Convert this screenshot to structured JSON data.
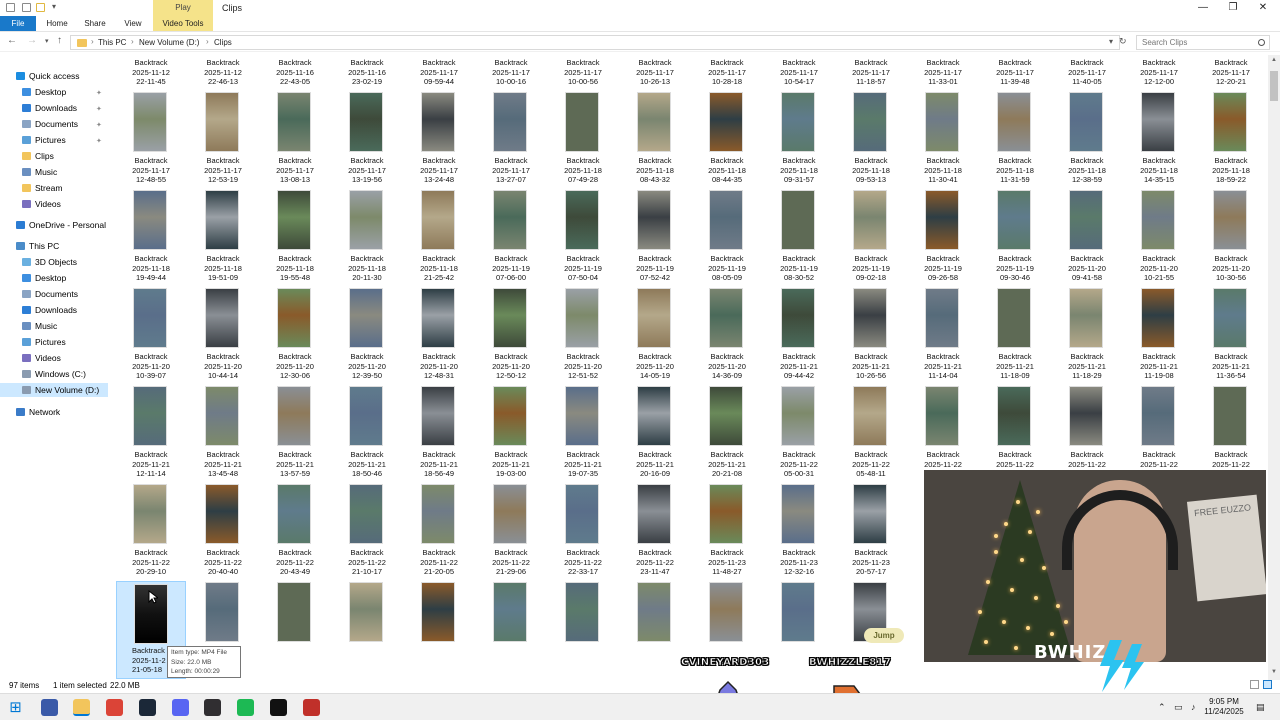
{
  "window": {
    "title": "Clips",
    "contextual_tab_group": "Play",
    "tabs": [
      "File",
      "Home",
      "Share",
      "View",
      "Video Tools"
    ],
    "minimize": "—",
    "maximize": "❐",
    "close": "✕"
  },
  "address": {
    "breadcrumbs": [
      "This PC",
      "New Volume (D:)",
      "Clips"
    ],
    "search_placeholder": "Search Clips"
  },
  "sidebar": {
    "items": [
      {
        "label": "Quick access",
        "indent": 0,
        "color": "#1b8de0",
        "pinned": false,
        "selected": false
      },
      {
        "label": "Desktop",
        "indent": 1,
        "color": "#3d8fe0",
        "pinned": true,
        "selected": false
      },
      {
        "label": "Downloads",
        "indent": 1,
        "color": "#2d7ed6",
        "pinned": true,
        "selected": false
      },
      {
        "label": "Documents",
        "indent": 1,
        "color": "#8aa4c4",
        "pinned": true,
        "selected": false
      },
      {
        "label": "Pictures",
        "indent": 1,
        "color": "#5aa0d8",
        "pinned": true,
        "selected": false
      },
      {
        "label": "Clips",
        "indent": 1,
        "color": "#f2c55c",
        "pinned": false,
        "selected": false
      },
      {
        "label": "Music",
        "indent": 1,
        "color": "#6a8fc0",
        "pinned": false,
        "selected": false
      },
      {
        "label": "Stream",
        "indent": 1,
        "color": "#f2c55c",
        "pinned": false,
        "selected": false
      },
      {
        "label": "Videos",
        "indent": 1,
        "color": "#7a6fbf",
        "pinned": false,
        "selected": false
      },
      {
        "label": "OneDrive - Personal",
        "indent": 0,
        "color": "#2b7cd3",
        "pinned": false,
        "selected": false
      },
      {
        "label": "This PC",
        "indent": 0,
        "color": "#4a8cc9",
        "pinned": false,
        "selected": false
      },
      {
        "label": "3D Objects",
        "indent": 1,
        "color": "#6ab0e0",
        "pinned": false,
        "selected": false
      },
      {
        "label": "Desktop",
        "indent": 1,
        "color": "#3d8fe0",
        "pinned": false,
        "selected": false
      },
      {
        "label": "Documents",
        "indent": 1,
        "color": "#8aa4c4",
        "pinned": false,
        "selected": false
      },
      {
        "label": "Downloads",
        "indent": 1,
        "color": "#2d7ed6",
        "pinned": false,
        "selected": false
      },
      {
        "label": "Music",
        "indent": 1,
        "color": "#6a8fc0",
        "pinned": false,
        "selected": false
      },
      {
        "label": "Pictures",
        "indent": 1,
        "color": "#5aa0d8",
        "pinned": false,
        "selected": false
      },
      {
        "label": "Videos",
        "indent": 1,
        "color": "#7a6fbf",
        "pinned": false,
        "selected": false
      },
      {
        "label": "Windows (C:)",
        "indent": 1,
        "color": "#8a9bb0",
        "pinned": false,
        "selected": false
      },
      {
        "label": "New Volume (D:)",
        "indent": 1,
        "color": "#8a9bb0",
        "pinned": false,
        "selected": true
      },
      {
        "label": "Network",
        "indent": 0,
        "color": "#3a7bc8",
        "pinned": false,
        "selected": false
      }
    ]
  },
  "files": {
    "name": "Backtrack",
    "items": [
      [
        "2025-11-12",
        "22-11-45"
      ],
      [
        "2025-11-12",
        "22-46-13"
      ],
      [
        "2025-11-16",
        "22-43-05"
      ],
      [
        "2025-11-16",
        "23-02-19"
      ],
      [
        "2025-11-17",
        "09-59-44"
      ],
      [
        "2025-11-17",
        "10-00-16"
      ],
      [
        "2025-11-17",
        "10-00-56"
      ],
      [
        "2025-11-17",
        "10-26-13"
      ],
      [
        "2025-11-17",
        "10-28-18"
      ],
      [
        "2025-11-17",
        "10-54-17"
      ],
      [
        "2025-11-17",
        "11-18-57"
      ],
      [
        "2025-11-17",
        "11-33-01"
      ],
      [
        "2025-11-17",
        "11-39-48"
      ],
      [
        "2025-11-17",
        "11-40-05"
      ],
      [
        "2025-11-17",
        "12-12-00"
      ],
      [
        "2025-11-17",
        "12-20-21"
      ],
      [
        "2025-11-17",
        "12-48-55"
      ],
      [
        "2025-11-17",
        "12-53-19"
      ],
      [
        "2025-11-17",
        "13-08-13"
      ],
      [
        "2025-11-17",
        "13-19-56"
      ],
      [
        "2025-11-17",
        "13-24-48"
      ],
      [
        "2025-11-17",
        "13-27-07"
      ],
      [
        "2025-11-18",
        "07-49-28"
      ],
      [
        "2025-11-18",
        "08-43-32"
      ],
      [
        "2025-11-18",
        "08-44-35"
      ],
      [
        "2025-11-18",
        "09-31-57"
      ],
      [
        "2025-11-18",
        "09-53-13"
      ],
      [
        "2025-11-18",
        "11-30-41"
      ],
      [
        "2025-11-18",
        "11-31-59"
      ],
      [
        "2025-11-18",
        "12-38-59"
      ],
      [
        "2025-11-18",
        "14-35-15"
      ],
      [
        "2025-11-18",
        "18-59-22"
      ],
      [
        "2025-11-18",
        "19-49-44"
      ],
      [
        "2025-11-18",
        "19-51-09"
      ],
      [
        "2025-11-18",
        "19-55-48"
      ],
      [
        "2025-11-18",
        "20-11-30"
      ],
      [
        "2025-11-18",
        "21-25-42"
      ],
      [
        "2025-11-19",
        "07-06-00"
      ],
      [
        "2025-11-19",
        "07-50-04"
      ],
      [
        "2025-11-19",
        "07-52-42"
      ],
      [
        "2025-11-19",
        "08-05-09"
      ],
      [
        "2025-11-19",
        "08-30-52"
      ],
      [
        "2025-11-19",
        "09-02-18"
      ],
      [
        "2025-11-19",
        "09-26-58"
      ],
      [
        "2025-11-19",
        "09-30-46"
      ],
      [
        "2025-11-20",
        "09-41-58"
      ],
      [
        "2025-11-20",
        "10-21-55"
      ],
      [
        "2025-11-20",
        "10-30-56"
      ],
      [
        "2025-11-20",
        "10-39-07"
      ],
      [
        "2025-11-20",
        "10-44-14"
      ],
      [
        "2025-11-20",
        "12-30-06"
      ],
      [
        "2025-11-20",
        "12-39-50"
      ],
      [
        "2025-11-20",
        "12-48-31"
      ],
      [
        "2025-11-20",
        "12-50-12"
      ],
      [
        "2025-11-20",
        "12-51-52"
      ],
      [
        "2025-11-20",
        "14-05-19"
      ],
      [
        "2025-11-20",
        "14-36-09"
      ],
      [
        "2025-11-21",
        "09-44-42"
      ],
      [
        "2025-11-21",
        "10-26-56"
      ],
      [
        "2025-11-21",
        "11-14-04"
      ],
      [
        "2025-11-21",
        "11-18-09"
      ],
      [
        "2025-11-21",
        "11-18-29"
      ],
      [
        "2025-11-21",
        "11-19-08"
      ],
      [
        "2025-11-21",
        "11-36-54"
      ],
      [
        "2025-11-21",
        "12-11-14"
      ],
      [
        "2025-11-21",
        "13-45-48"
      ],
      [
        "2025-11-21",
        "13-57-59"
      ],
      [
        "2025-11-21",
        "18-50-46"
      ],
      [
        "2025-11-21",
        "18-56-49"
      ],
      [
        "2025-11-21",
        "19-03-00"
      ],
      [
        "2025-11-21",
        "19-07-35"
      ],
      [
        "2025-11-21",
        "20-16-09"
      ],
      [
        "2025-11-21",
        "20-21-08"
      ],
      [
        "2025-11-22",
        "05-00-31"
      ],
      [
        "2025-11-22",
        "05-48-11"
      ],
      [
        "2025-11-22",
        ""
      ],
      [
        "2025-11-22",
        ""
      ],
      [
        "2025-11-22",
        ""
      ],
      [
        "2025-11-22",
        ""
      ],
      [
        "2025-11-22",
        ""
      ],
      [
        "2025-11-22",
        "20-29-10"
      ],
      [
        "2025-11-22",
        "20-40-40"
      ],
      [
        "2025-11-22",
        "20-43-49"
      ],
      [
        "2025-11-22",
        "21-10-17"
      ],
      [
        "2025-11-22",
        "21-20-05"
      ],
      [
        "2025-11-22",
        "21-29-06"
      ],
      [
        "2025-11-22",
        "22-33-17"
      ],
      [
        "2025-11-22",
        "23-11-47"
      ],
      [
        "2025-11-23",
        "11-48-27"
      ],
      [
        "2025-11-23",
        "12-32-16"
      ],
      [
        "2025-11-23",
        "20-57-17"
      ],
      [
        "2025-11-2",
        "21-05-18"
      ]
    ],
    "thumb_colors": [
      "#7d8a6a",
      "#6f7b88",
      "#3e4a3a",
      "#8a8f95",
      "#5e6a55",
      "#9aa0a6",
      "#5f7b8c",
      "#b4a88a",
      "#8e7a5a",
      "#3a3f44",
      "#8a5a2a",
      "#7a8570",
      "#6a8a5a",
      "#5a7a6a",
      "#4a6a5a",
      "#5a6e8a",
      "#566b7a",
      "#8a8a80",
      "#2e3e45"
    ]
  },
  "tooltip": {
    "type": "Item type: MP4 File",
    "size": "Size: 22.0 MB",
    "length": "Length: 00:00:29"
  },
  "statusbar": {
    "count": "97 items",
    "selection": "1 item selected",
    "size": "22.0 MB"
  },
  "overlay": {
    "jump_label": "Jump",
    "names": [
      "CVINEYARD303",
      "BWHIZZLE817"
    ],
    "webcam_logo": "BWHIZ",
    "sign_text": "FREE EUZZO"
  },
  "taskbar": {
    "time": "9:05 PM",
    "date": "11/24/2025",
    "apps": [
      {
        "name": "windows-start",
        "color": "#0078d4"
      },
      {
        "name": "task-view",
        "color": "#3a5aa8"
      },
      {
        "name": "file-explorer",
        "color": "#f2c55c"
      },
      {
        "name": "chrome",
        "color": "#db4437"
      },
      {
        "name": "steam",
        "color": "#1b2838"
      },
      {
        "name": "discord",
        "color": "#5865f2"
      },
      {
        "name": "obs",
        "color": "#302e31"
      },
      {
        "name": "spotify",
        "color": "#1db954"
      },
      {
        "name": "capcut",
        "color": "#111111"
      },
      {
        "name": "app-red",
        "color": "#c0302a"
      }
    ]
  }
}
